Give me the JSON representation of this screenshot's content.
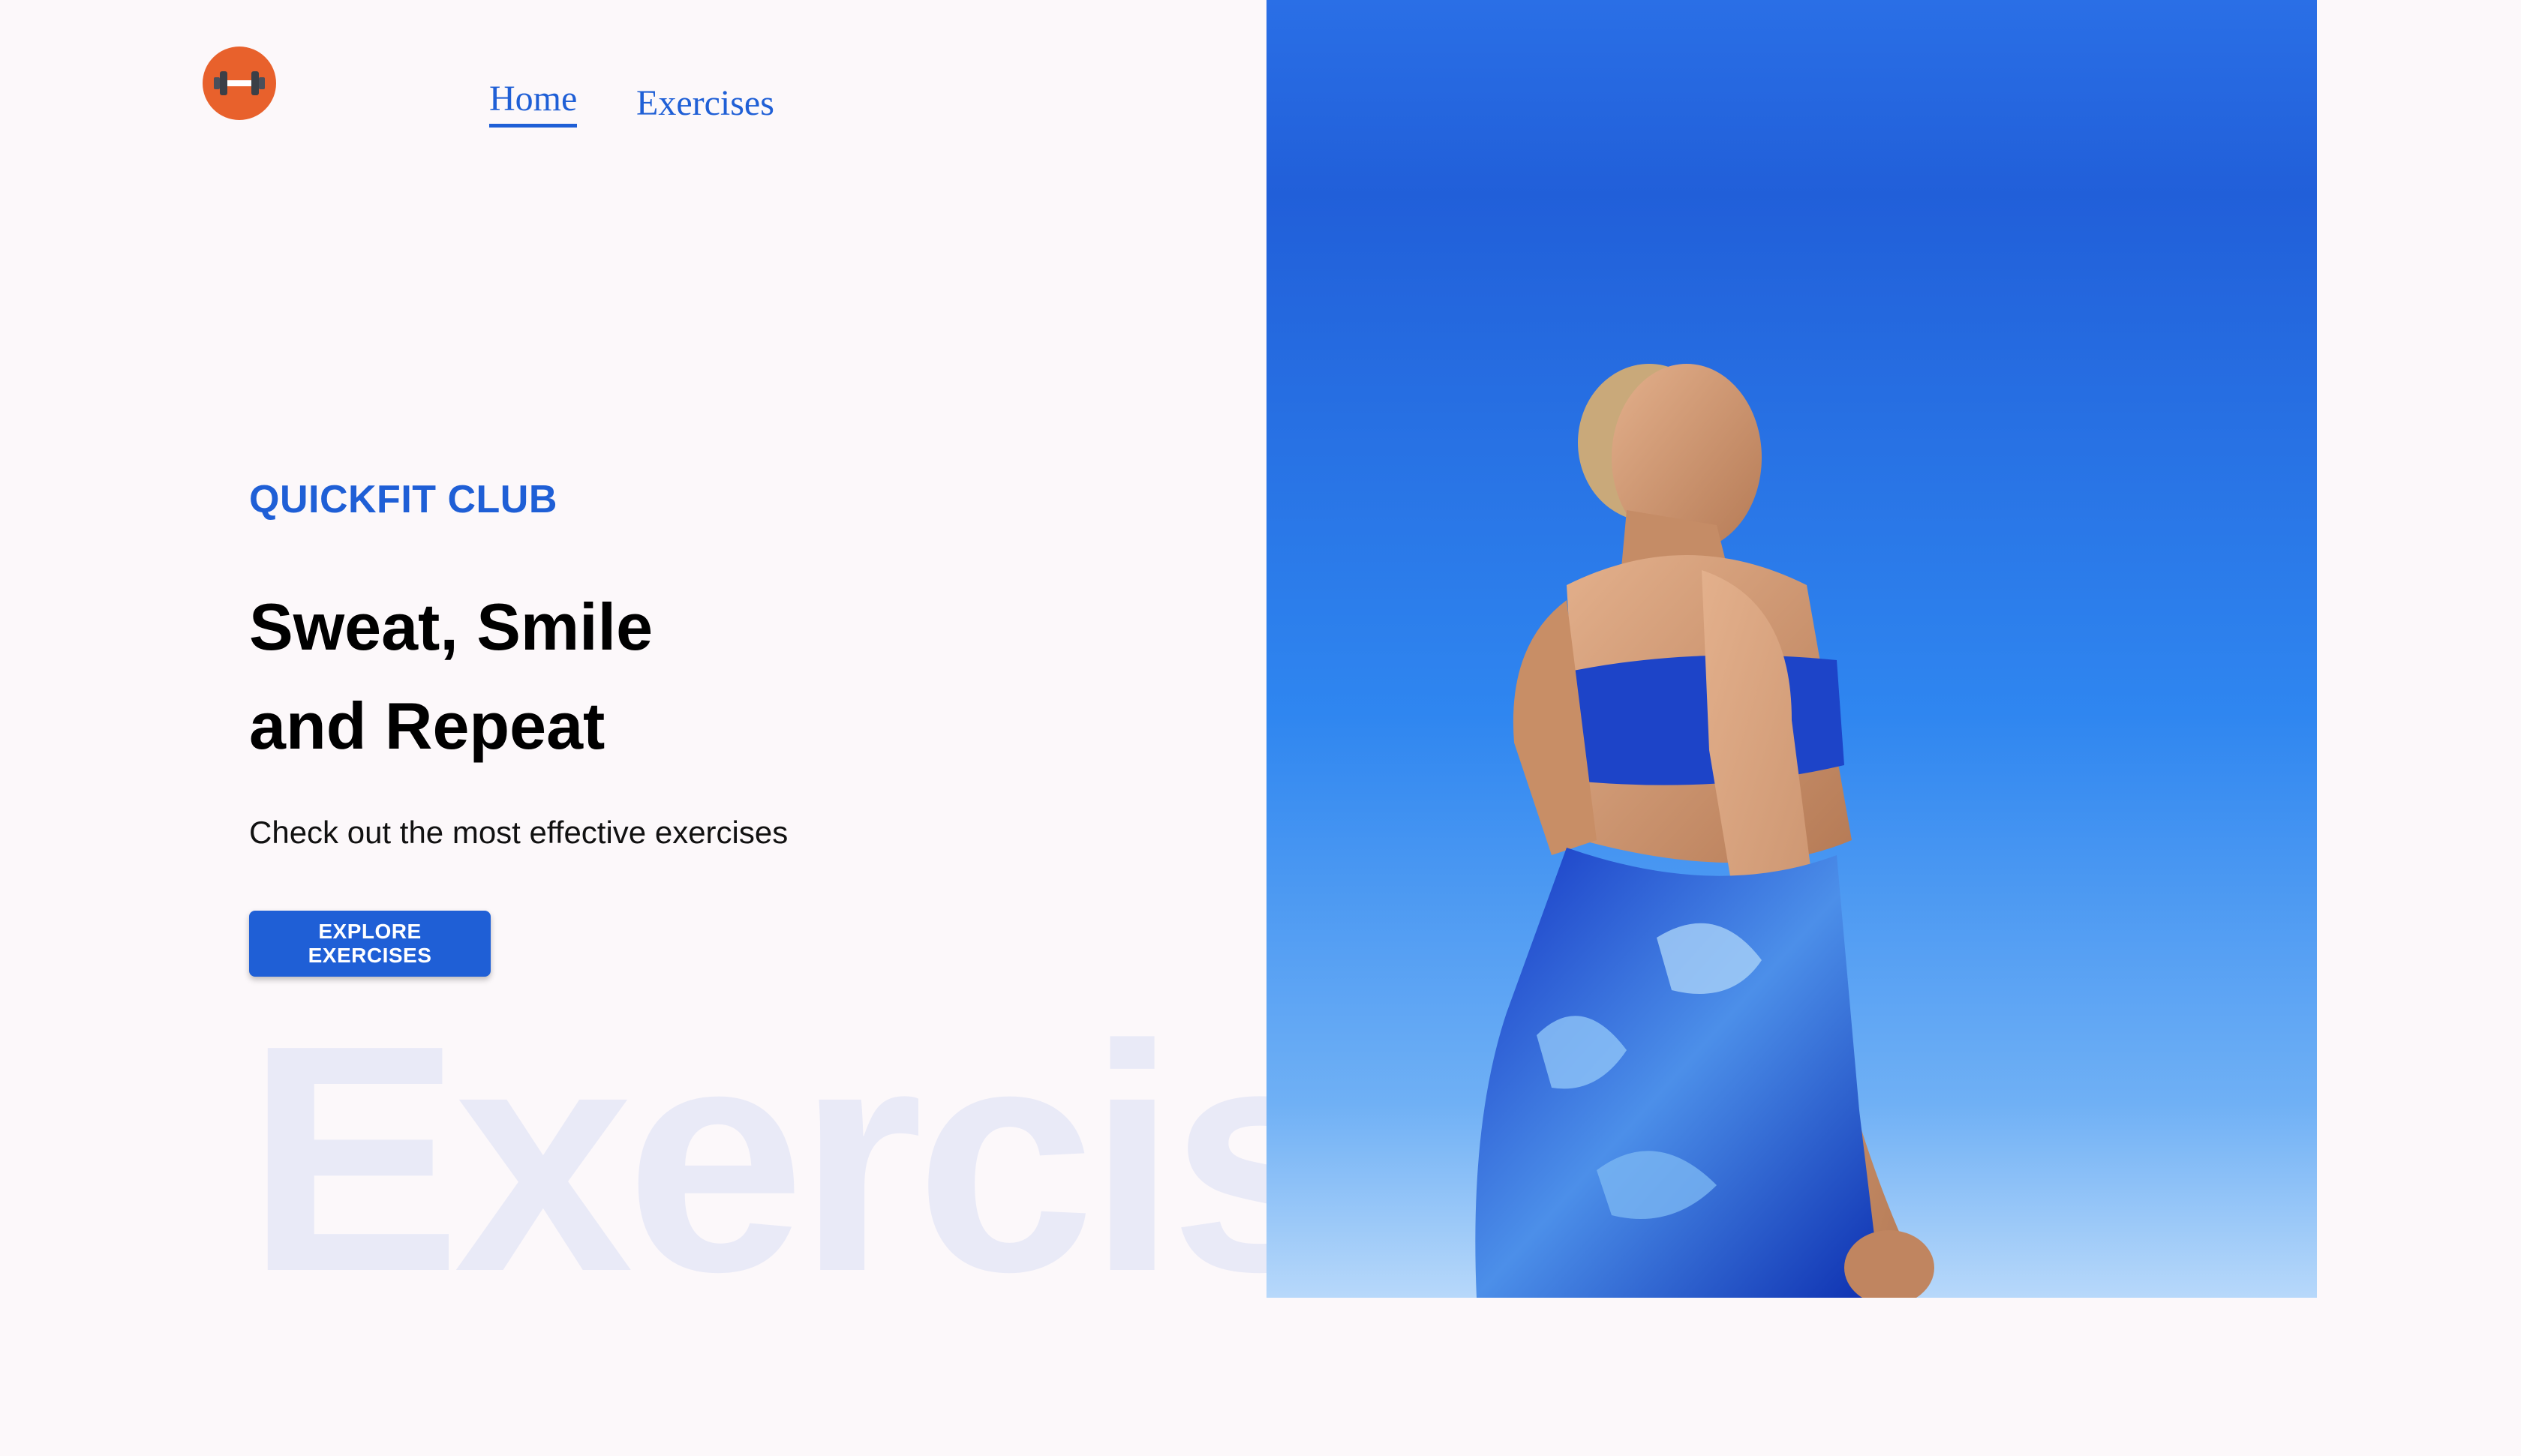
{
  "nav": {
    "logo_icon": "dumbbell-icon",
    "links": [
      {
        "label": "Home",
        "active": true
      },
      {
        "label": "Exercises",
        "active": false
      }
    ]
  },
  "hero": {
    "eyebrow": "QUICKFIT CLUB",
    "headline_line1": "Sweat, Smile",
    "headline_line2": "and Repeat",
    "subtitle": "Check out the most effective exercises",
    "cta_label": "EXPLORE EXERCISES",
    "watermark": "Exercise"
  },
  "colors": {
    "accent": "#1f5fd6",
    "logo_bg": "#e8612c",
    "page_bg": "#fcf8fa",
    "watermark": "#e9eaf7",
    "sky": "#2f7df0"
  }
}
